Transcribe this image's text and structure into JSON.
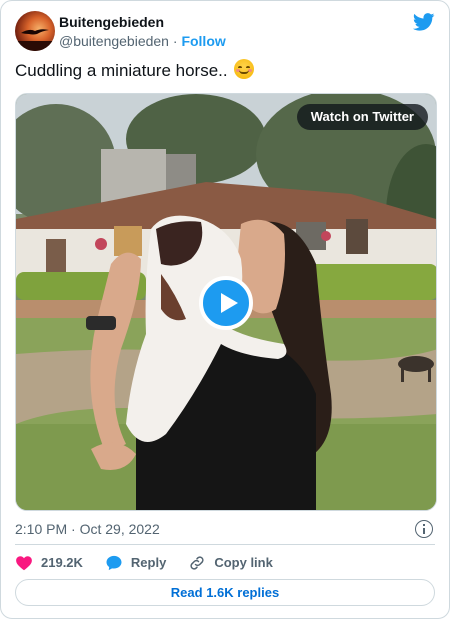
{
  "author": {
    "display_name": "Buitengebieden",
    "handle": "@buitengebieden",
    "separator": "·",
    "follow_label": "Follow"
  },
  "tweet": {
    "text": "Cuddling a miniature horse..",
    "emoji_icon": "smiling-face-icon"
  },
  "media": {
    "watch_label": "Watch on Twitter",
    "play_icon": "play-icon"
  },
  "meta": {
    "timestamp": "2:10 PM · Oct 29, 2022"
  },
  "actions": {
    "likes": "219.2K",
    "reply_label": "Reply",
    "copy_link_label": "Copy link"
  },
  "read_replies_label": "Read 1.6K replies",
  "colors": {
    "brand_blue": "#1d9bf0",
    "like_pink": "#f91880",
    "text_secondary": "#536471",
    "border": "#cfd9de"
  }
}
